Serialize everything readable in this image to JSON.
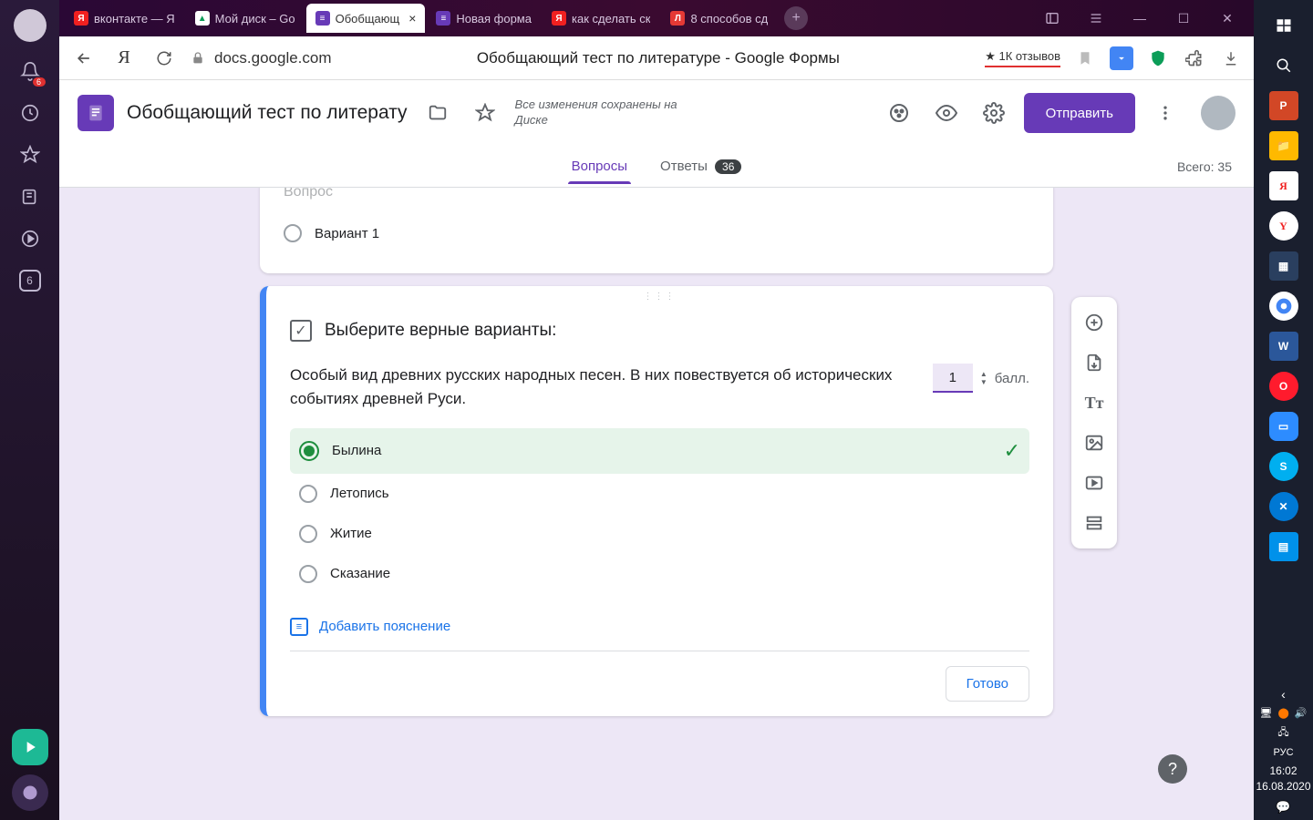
{
  "browser_sidebar": {
    "notif_count": "6",
    "counter_badge": "6"
  },
  "tabs": [
    {
      "label": "вконтакте — Я",
      "favicon_bg": "#f02020",
      "favicon_text": "Я",
      "favicon_color": "#fff"
    },
    {
      "label": "Мой диск – Go",
      "favicon_bg": "#fff",
      "favicon_text": "▲",
      "favicon_color": "#0f9d58"
    },
    {
      "label": "Обобщающ",
      "favicon_bg": "#673ab7",
      "favicon_text": "≡",
      "favicon_color": "#fff",
      "active": true
    },
    {
      "label": "Новая форма",
      "favicon_bg": "#673ab7",
      "favicon_text": "≡",
      "favicon_color": "#fff"
    },
    {
      "label": "как сделать ск",
      "favicon_bg": "#f02020",
      "favicon_text": "Я",
      "favicon_color": "#fff"
    },
    {
      "label": "8 способов сд",
      "favicon_bg": "#e53935",
      "favicon_text": "Л",
      "favicon_color": "#fff"
    }
  ],
  "address": {
    "host": "docs.google.com",
    "page_title": "Обобщающий тест по литературе - Google Формы",
    "reviews": "★ 1К отзывов"
  },
  "forms_header": {
    "title": "Обобщающий тест по литерату",
    "save_status": "Все изменения сохранены на Диске",
    "send_label": "Отправить"
  },
  "forms_tabs": {
    "questions": "Вопросы",
    "answers": "Ответы",
    "answers_count": "36",
    "total": "Всего: 35"
  },
  "prev_card": {
    "title": "Вопрос",
    "option1": "Вариант 1"
  },
  "current_card": {
    "header": "Выберите верные варианты:",
    "question": "Особый вид древних русских народных песен. В них повествуется об исторических событиях древней Руси.",
    "points_value": "1",
    "points_label": "балл.",
    "options": [
      {
        "label": "Былина",
        "correct": true
      },
      {
        "label": "Летопись",
        "correct": false
      },
      {
        "label": "Житие",
        "correct": false
      },
      {
        "label": "Сказание",
        "correct": false
      }
    ],
    "add_feedback": "Добавить пояснение",
    "done": "Готово"
  },
  "win": {
    "lang": "РУС",
    "time": "16:02",
    "date": "16.08.2020"
  }
}
